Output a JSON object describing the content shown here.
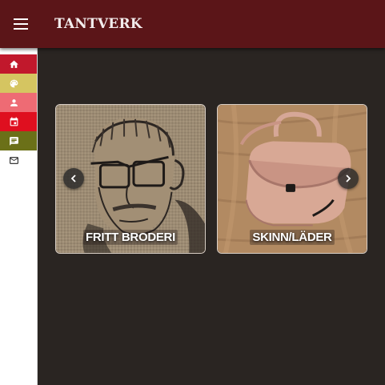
{
  "appbar": {
    "title": "TANTVERK",
    "menu_icon": "hamburger-menu-icon",
    "background": "#5b1518"
  },
  "rail": {
    "items": [
      {
        "icon": "home-icon",
        "color": "#c1182c"
      },
      {
        "icon": "palette-icon",
        "color": "#d5c561"
      },
      {
        "icon": "person-icon",
        "color": "#ee6b74"
      },
      {
        "icon": "calendar-icon",
        "color": "#df0f1f"
      },
      {
        "icon": "chat-icon",
        "color": "#6b7018"
      },
      {
        "icon": "mail-icon",
        "color": "#ffffff"
      }
    ]
  },
  "carousel": {
    "prev_icon": "chevron-left-icon",
    "next_icon": "chevron-right-icon",
    "cards": [
      {
        "label": "FRITT BRODERI",
        "image": "embroidered-portrait-image"
      },
      {
        "label": "SKINN/LÄDER",
        "image": "leather-bag-image"
      }
    ]
  }
}
